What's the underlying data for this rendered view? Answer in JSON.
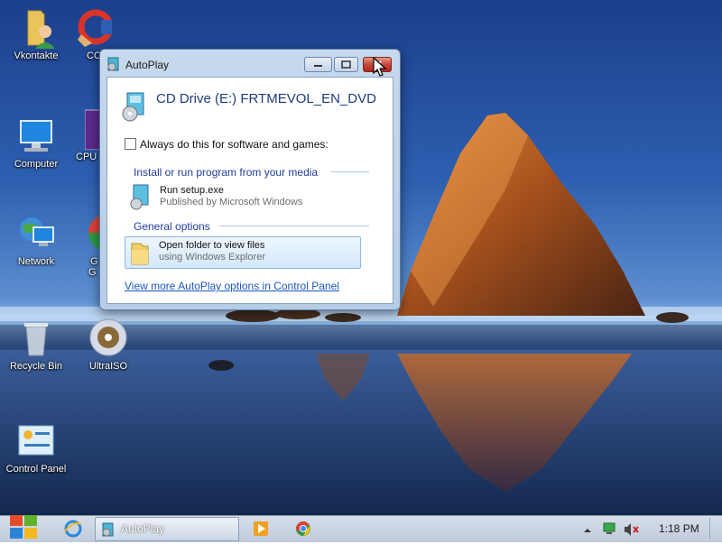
{
  "desktop": {
    "icons": [
      {
        "label": "Vkontakte",
        "icon": "folder-user-icon"
      },
      {
        "label": "CC",
        "icon": "ccleaner-icon"
      },
      {
        "label": "Computer",
        "icon": "computer-icon"
      },
      {
        "label": "CPU",
        "icon": "cpuz-icon"
      },
      {
        "label": "Network",
        "icon": "network-icon"
      },
      {
        "label": "G",
        "label2": "G",
        "icon": "chrome-icon"
      },
      {
        "label": "Recycle Bin",
        "icon": "recycle-bin-icon"
      },
      {
        "label": "UltraISO",
        "icon": "ultraiso-icon"
      },
      {
        "label": "Control Panel",
        "icon": "control-panel-icon"
      }
    ]
  },
  "autoplay": {
    "title": "AutoPlay",
    "heading": "CD Drive (E:) FRTMEVOL_EN_DVD",
    "always_label": "Always do this for software and games:",
    "section_install": "Install or run program from your media",
    "run_setup_title": "Run setup.exe",
    "run_setup_sub": "Published by Microsoft Windows",
    "section_general": "General options",
    "open_folder_title": "Open folder to view files",
    "open_folder_sub": "using Windows Explorer",
    "control_panel_link": "View more AutoPlay options in Control Panel"
  },
  "taskbar": {
    "task_label": "AutoPlay",
    "clock": "1:18 PM"
  },
  "colors": {
    "link": "#1c55c5",
    "section": "#1f3d9e",
    "heading": "#1f3d7a",
    "close_button": "#c8443a"
  }
}
